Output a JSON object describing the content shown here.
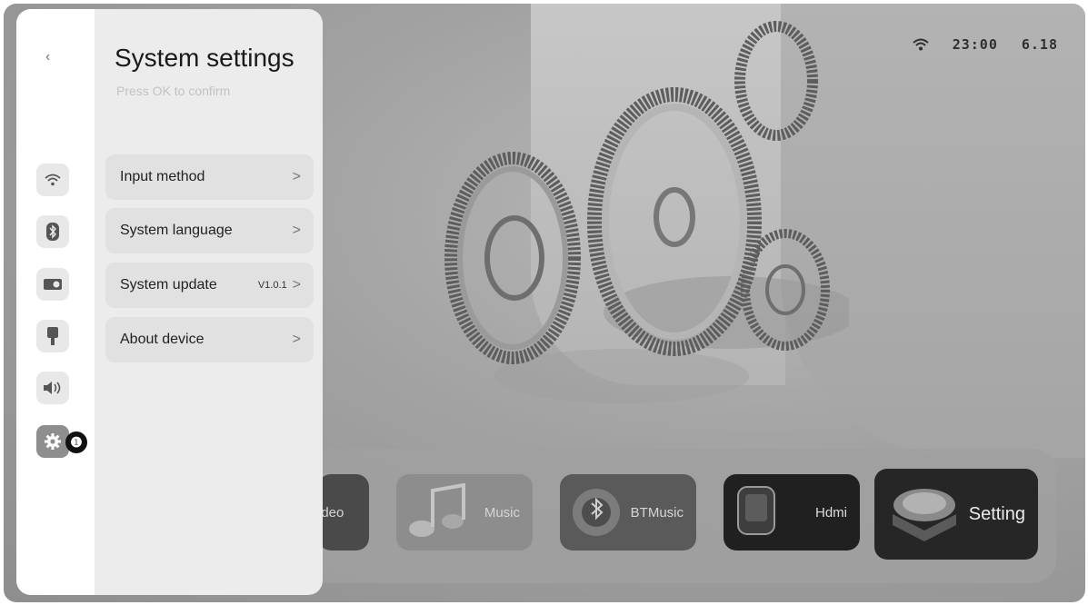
{
  "status": {
    "time": "23:00",
    "date": "6.18",
    "wifi_icon": "wifi-icon"
  },
  "panel": {
    "title": "System settings",
    "subtitle": "Press OK to confirm",
    "back_icon": "chevron-left-icon",
    "rail": [
      {
        "name": "wifi",
        "icon": "wifi-icon"
      },
      {
        "name": "bluetooth",
        "icon": "bluetooth-icon"
      },
      {
        "name": "projector",
        "icon": "projector-icon"
      },
      {
        "name": "stand",
        "icon": "stand-icon"
      },
      {
        "name": "sound",
        "icon": "speaker-icon"
      },
      {
        "name": "settings",
        "icon": "gear-icon",
        "active": true
      }
    ],
    "badge": "❶",
    "menu": [
      {
        "label": "Input method",
        "value": "",
        "chevron": ">"
      },
      {
        "label": "System language",
        "value": "",
        "chevron": ">"
      },
      {
        "label": "System update",
        "value": "V1.0.1",
        "chevron": ">"
      },
      {
        "label": "About device",
        "value": "",
        "chevron": ">"
      }
    ]
  },
  "dock": {
    "apps": [
      {
        "label": "Video",
        "visible_label": "ideo"
      },
      {
        "label": "Music"
      },
      {
        "label": "BTMusic"
      },
      {
        "label": "Hdmi"
      },
      {
        "label": "Setting",
        "selected": true
      }
    ]
  }
}
